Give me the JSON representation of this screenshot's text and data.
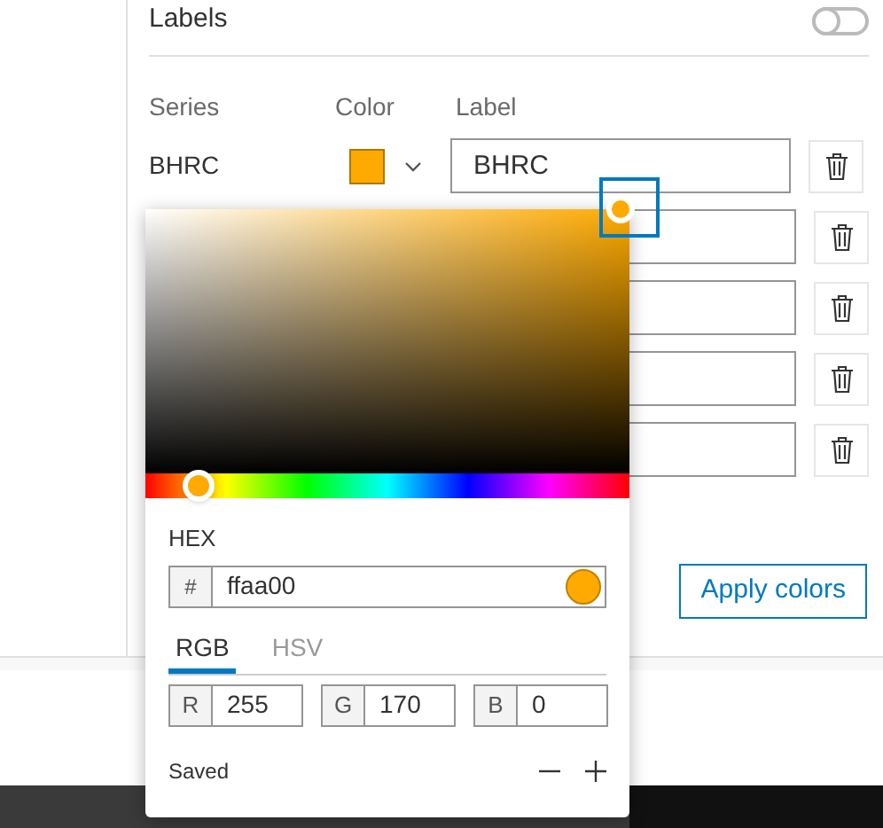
{
  "labels": {
    "label": "Labels",
    "on": false
  },
  "columns": [
    "Series",
    "Color",
    "Label"
  ],
  "rows": [
    {
      "kind": "full",
      "series": "BHRC",
      "color": "#ffaa00",
      "label": "BHRC"
    },
    {
      "kind": "covered"
    },
    {
      "kind": "covered"
    },
    {
      "kind": "covered"
    },
    {
      "kind": "covered"
    }
  ],
  "apply_button": "Apply colors",
  "picker": {
    "hue": {
      "level": 0.11
    },
    "hex_label": "HEX",
    "hex_prefix": "#",
    "hex_value": "ffaa00",
    "tabs": [
      {
        "label": "RGB",
        "selected": true
      },
      {
        "label": "HSV",
        "selected": false
      }
    ],
    "channels": [
      {
        "label": "R",
        "value": "255"
      },
      {
        "label": "G",
        "value": "170"
      },
      {
        "label": "B",
        "value": "0"
      }
    ],
    "saved_label": "Saved"
  }
}
